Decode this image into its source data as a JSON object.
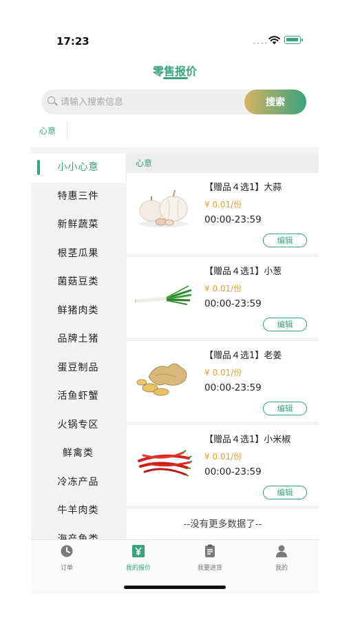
{
  "status_bar": {
    "time": "17:23",
    "signal_dots": "••••"
  },
  "header": {
    "title": "零售报价"
  },
  "search": {
    "placeholder": "请输入搜索信息",
    "button_label": "搜索"
  },
  "filter_chip": "心意",
  "sidebar": {
    "items": [
      "小小心意",
      "特惠三件",
      "新鲜蔬菜",
      "根茎瓜果",
      "菌菇豆类",
      "鲜猪肉类",
      "品牌土猪",
      "蛋豆制品",
      "活鱼虾蟹",
      "火锅专区",
      "鲜禽类",
      "冷冻产品",
      "牛羊肉类",
      "海产鱼类"
    ],
    "active_index": 0
  },
  "section": {
    "label": "心意"
  },
  "products": [
    {
      "name": "【赠品４选1】大蒜",
      "price": "¥ 0.01/份",
      "hours": "00:00-23:59",
      "edit_label": "编辑",
      "image": "garlic"
    },
    {
      "name": "【赠品４选1】小葱",
      "price": "¥ 0.01/份",
      "hours": "00:00-23:59",
      "edit_label": "编辑",
      "image": "scallion"
    },
    {
      "name": "【赠品４选1】老姜",
      "price": "¥ 0.01/份",
      "hours": "00:00-23:59",
      "edit_label": "编辑",
      "image": "ginger"
    },
    {
      "name": "【赠品４选1】小米椒",
      "price": "¥ 0.01/份",
      "hours": "00:00-23:59",
      "edit_label": "编辑",
      "image": "chili-pepper"
    }
  ],
  "list_end": "--没有更多数据了--",
  "tabbar": {
    "tabs": [
      {
        "label": "订单",
        "icon": "clock-icon"
      },
      {
        "label": "我的报价",
        "icon": "yen-icon"
      },
      {
        "label": "我要进货",
        "icon": "clipboard-icon"
      },
      {
        "label": "我的",
        "icon": "user-icon"
      }
    ],
    "active_index": 1
  },
  "colors": {
    "accent": "#3aa27e",
    "price": "#e9a024",
    "search_gradient_start": "#d7b262"
  }
}
